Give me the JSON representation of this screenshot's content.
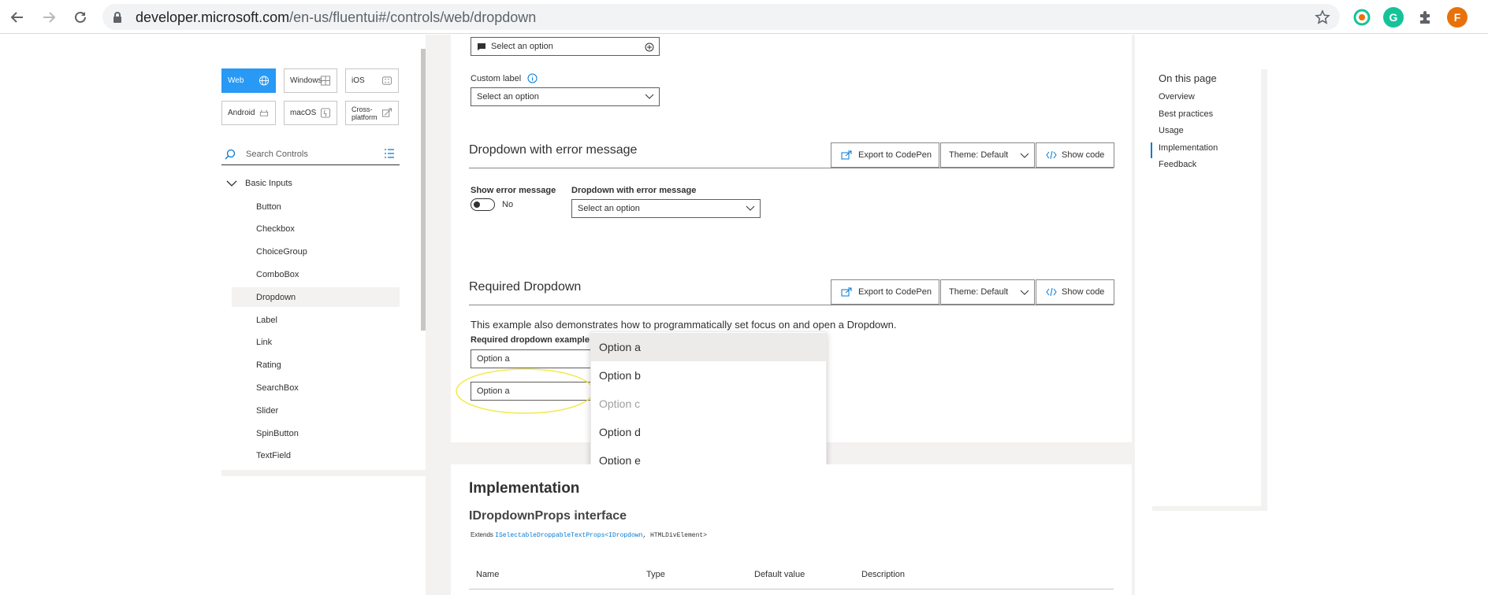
{
  "browser": {
    "url_host": "developer.microsoft.com",
    "url_path": "/en-us/fluentui#/controls/web/dropdown",
    "profile_initial": "F",
    "colors": {
      "accent": "#1a73e8",
      "profile": "#e8710a",
      "grammarly": "#15c39a"
    }
  },
  "sidebar": {
    "platforms": [
      {
        "label": "Web",
        "icon": "globe-icon",
        "active": true
      },
      {
        "label": "Windows",
        "icon": "windows-icon",
        "active": false
      },
      {
        "label": "iOS",
        "icon": "ios-icon",
        "active": false
      },
      {
        "label": "Android",
        "icon": "android-icon",
        "active": false
      },
      {
        "label": "macOS",
        "icon": "macos-icon",
        "active": false
      },
      {
        "label": "Cross-platform",
        "icon": "cross-platform-icon",
        "active": false
      }
    ],
    "search_placeholder": "Search Controls",
    "group_label": "Basic Inputs",
    "items": [
      "Button",
      "Checkbox",
      "ChoiceGroup",
      "ComboBox",
      "Dropdown",
      "Label",
      "Link",
      "Rating",
      "SearchBox",
      "Slider",
      "SpinButton",
      "TextField"
    ],
    "selected_item": "Dropdown"
  },
  "top_card": {
    "dropdown1_value": "Select an option",
    "custom_label": "Custom label",
    "dropdown2_value": "Select an option"
  },
  "error_section": {
    "title": "Dropdown with error message",
    "export_label": "Export to CodePen",
    "theme_label": "Theme: Default",
    "show_code_label": "Show code",
    "toggle_label": "Show error message",
    "toggle_state": "No",
    "dropdown_label": "Dropdown with error message",
    "dropdown_value": "Select an option"
  },
  "required_section": {
    "title": "Required Dropdown",
    "export_label": "Export to CodePen",
    "theme_label": "Theme: Default",
    "show_code_label": "Show code",
    "description": "This example also demonstrates how to programmatically set focus on and open a Dropdown.",
    "dropdown_label": "Required dropdown example",
    "dropdown1_value": "Option a",
    "dropdown2_value": "Option a"
  },
  "callout": {
    "options": [
      {
        "label": "Option a",
        "state": "hover"
      },
      {
        "label": "Option b",
        "state": "normal"
      },
      {
        "label": "Option c",
        "state": "disabled"
      },
      {
        "label": "Option d",
        "state": "normal"
      },
      {
        "label": "Option e",
        "state": "normal"
      }
    ]
  },
  "implementation": {
    "title": "Implementation",
    "interface_title": "IDropdownProps interface",
    "extends_label": "Extends",
    "extends_link": "ISelectableDroppableTextProps<IDropdown",
    "extends_rest": ", HTMLDivElement>",
    "columns": [
      "Name",
      "Type",
      "Default value",
      "Description"
    ]
  },
  "toc": {
    "title": "On this page",
    "items": [
      "Overview",
      "Best practices",
      "Usage",
      "Implementation",
      "Feedback"
    ],
    "active_item": "Implementation"
  }
}
